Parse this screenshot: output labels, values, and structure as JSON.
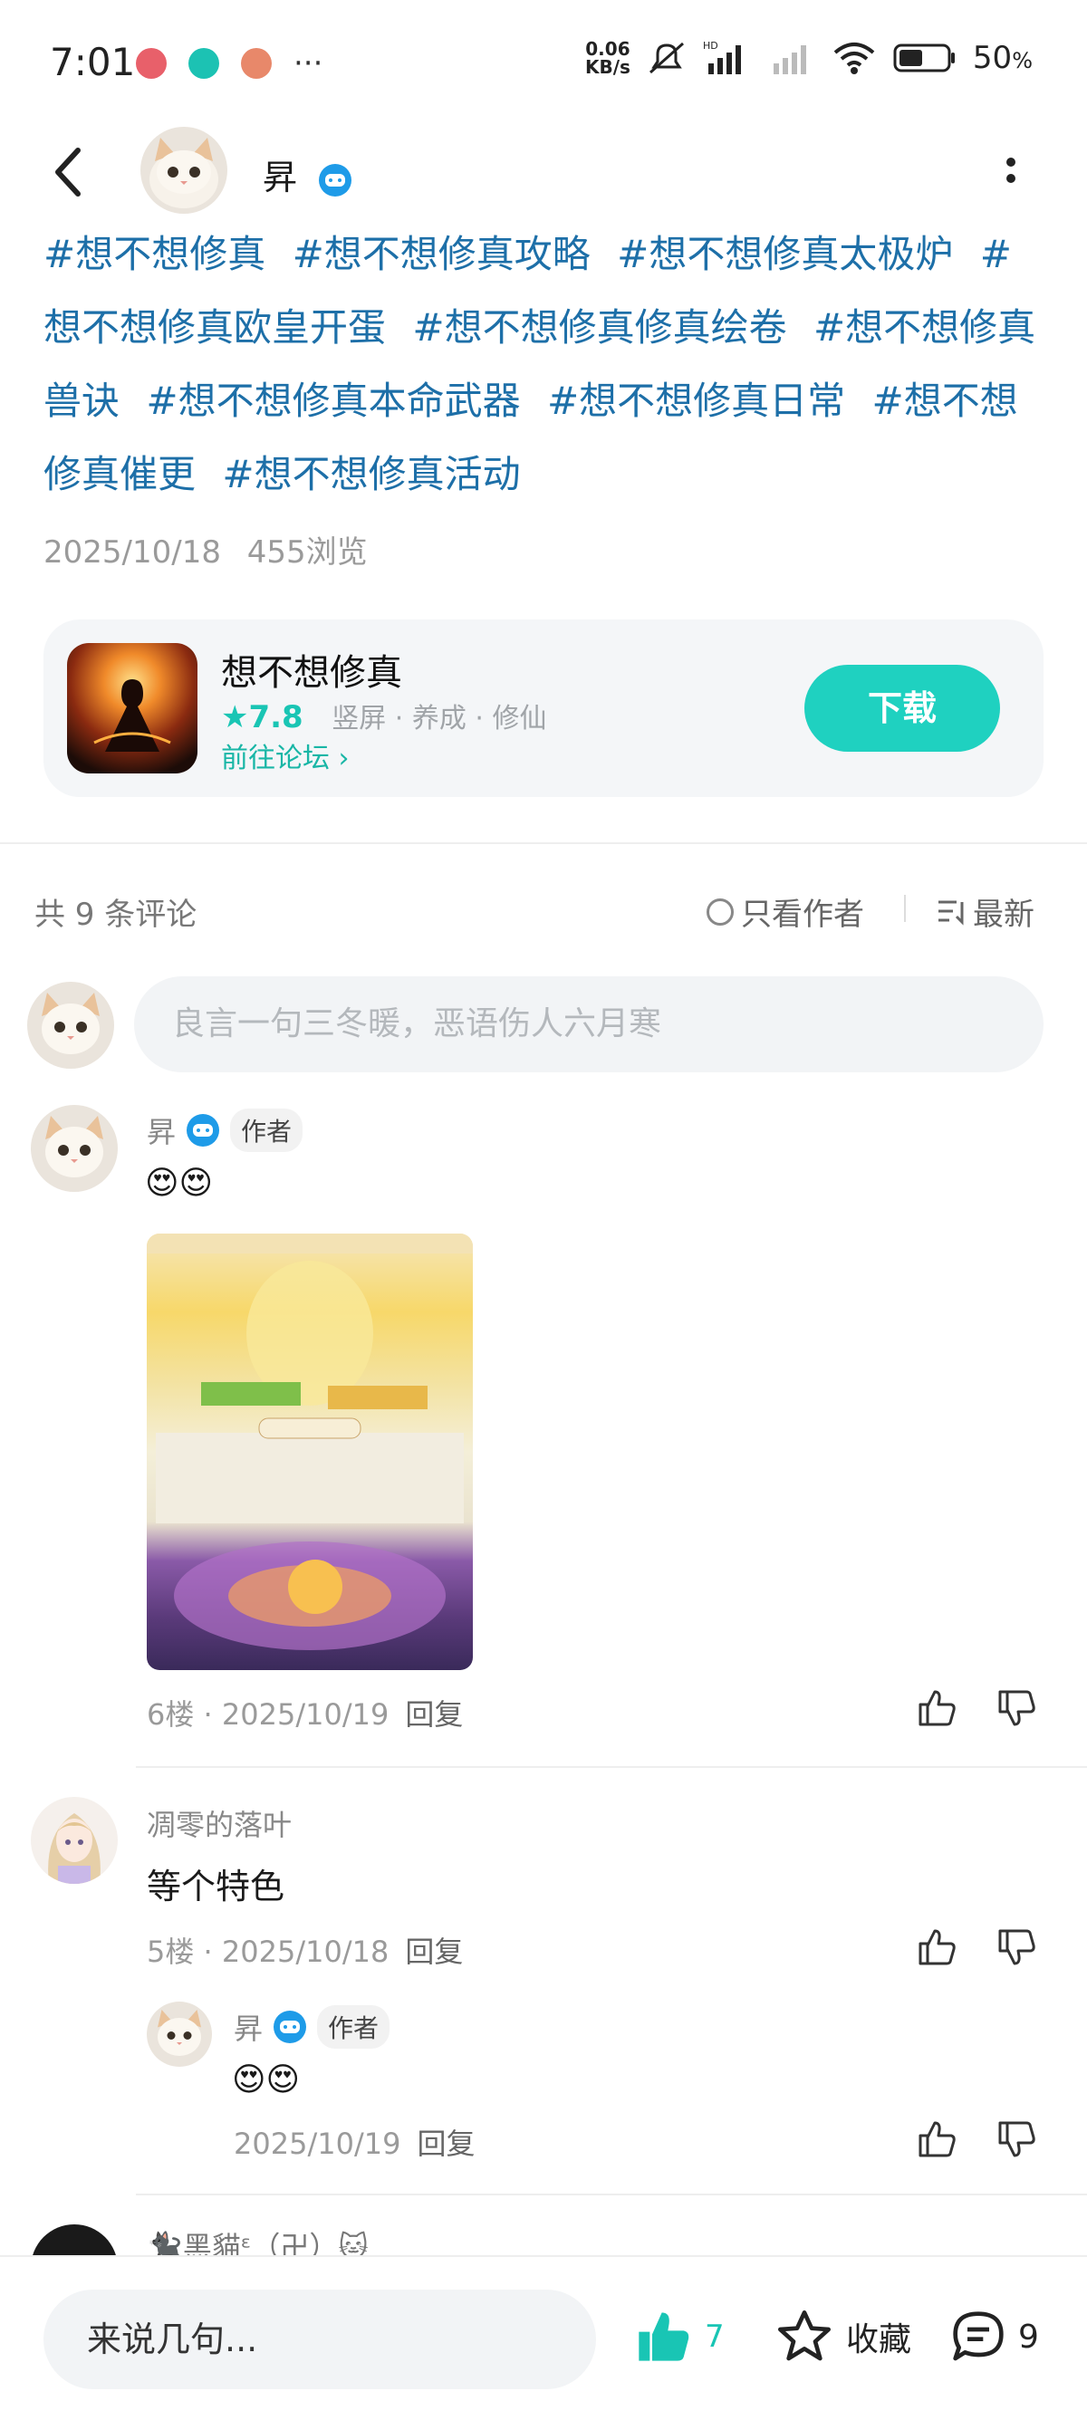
{
  "status_bar": {
    "time": "7:01",
    "net_speed_value": "0.06",
    "net_speed_unit": "KB/s",
    "battery": "50",
    "battery_unit": "%"
  },
  "post": {
    "author": "昇",
    "tags": [
      "#想不想修真",
      "#想不想修真攻略",
      "#想不想修真太极炉",
      "#想不想修真欧皇开蛋",
      "#想不想修真修真绘卷",
      "#想不想修真兽诀",
      "#想不想修真本命武器",
      "#想不想修真日常",
      "#想不想修真催更",
      "#想不想修真活动"
    ],
    "date": "2025/10/18",
    "views": "455浏览"
  },
  "game_card": {
    "title": "想不想修真",
    "rating": "7.8",
    "genres": "竖屏 · 养成 · 修仙",
    "forum_link": "前往论坛",
    "download_label": "下载"
  },
  "comments_header": {
    "count_text": "共 9 条评论",
    "only_author": "只看作者",
    "sort": "最新"
  },
  "composer": {
    "placeholder": "良言一句三冬暖，恶语伤人六月寒"
  },
  "comments": [
    {
      "name": "昇",
      "author_tag": "作者",
      "content": "😍😍",
      "floor": "6楼",
      "date": "2025/10/19",
      "reply": "回复"
    },
    {
      "name": "凋零的落叶",
      "content": "等个特色",
      "floor": "5楼",
      "date": "2025/10/18",
      "reply": "回复",
      "sub_reply": {
        "name": "昇",
        "author_tag": "作者",
        "content": "😍😍",
        "date": "2025/10/19",
        "reply": "回复"
      }
    },
    {
      "name": "🐈‍⬛黑貓ᵋ（卍）🐱"
    }
  ],
  "bottom_bar": {
    "input_placeholder": "来说几句...",
    "likes": "7",
    "favorite_label": "收藏",
    "comments": "9"
  },
  "colors": {
    "accent": "#1fd1c0",
    "tag_blue": "#1d6fa8",
    "badge_blue": "#1e9be8"
  }
}
